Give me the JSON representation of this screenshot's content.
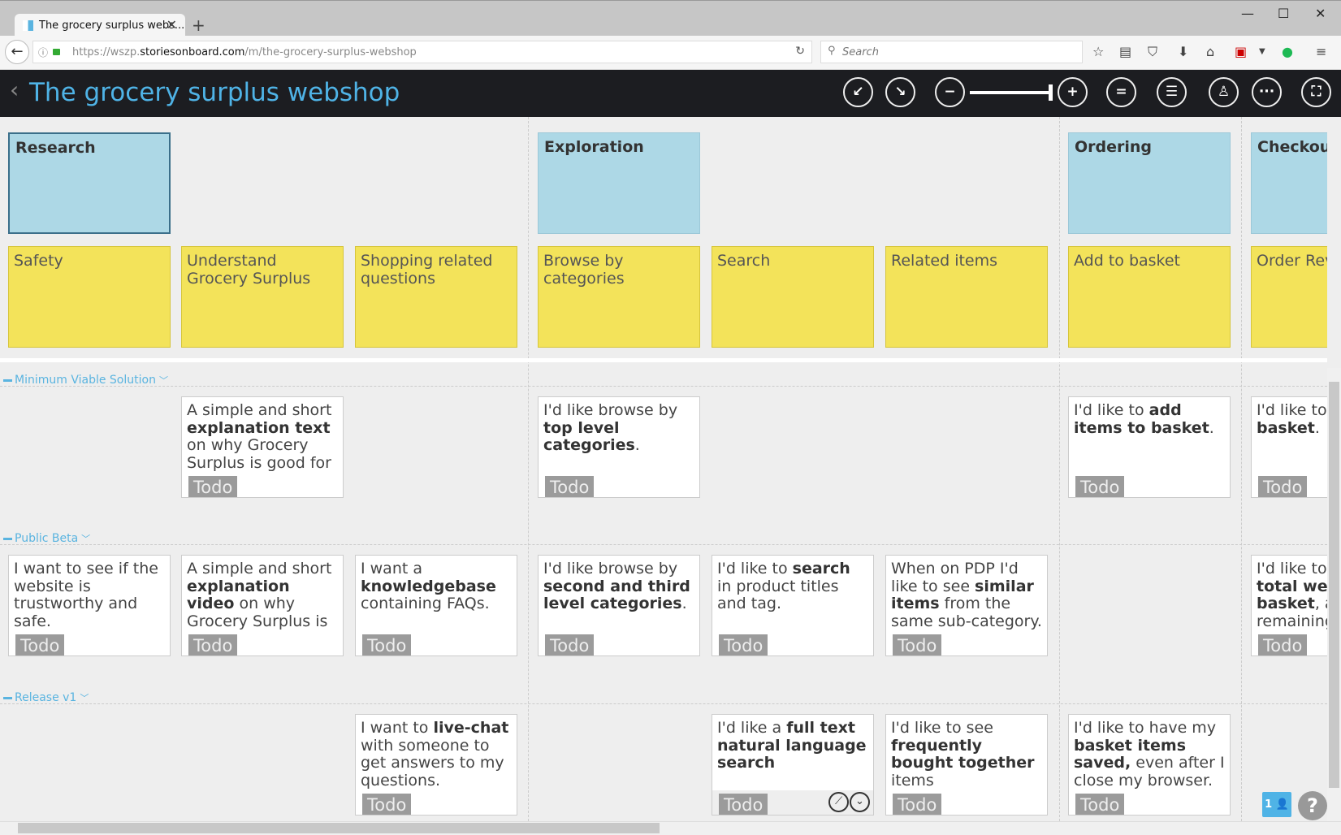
{
  "browser": {
    "tab_title": "The grocery surplus webs...",
    "url_prefix": "https://wszp.",
    "url_domain": "storiesonboard.com",
    "url_path": "/m/the-grocery-surplus-webshop",
    "search_placeholder": "Search"
  },
  "header": {
    "title": "The grocery surplus webshop"
  },
  "columns": [
    {
      "epic": "Research",
      "activity": "Safety",
      "selected": true
    },
    {
      "epic": null,
      "activity": "Understand Grocery Surplus"
    },
    {
      "epic": null,
      "activity": "Shopping related questions"
    },
    {
      "epic": "Exploration",
      "activity": "Browse by categories"
    },
    {
      "epic": null,
      "activity": "Search"
    },
    {
      "epic": null,
      "activity": "Related items"
    },
    {
      "epic": "Ordering",
      "activity": "Add to basket"
    },
    {
      "epic": "Checkout",
      "activity": "Order Review"
    }
  ],
  "releases": [
    {
      "name": "Minimum Viable Solution",
      "cards": [
        {
          "col": 1,
          "status": "Todo",
          "text": [
            {
              "t": "A simple and short "
            },
            {
              "t": "explanation text",
              "b": true
            },
            {
              "t": " on why Grocery Surplus is good for me."
            }
          ]
        },
        {
          "col": 3,
          "status": "Todo",
          "text": [
            {
              "t": "I'd like browse by "
            },
            {
              "t": "top level categories",
              "b": true
            },
            {
              "t": "."
            }
          ]
        },
        {
          "col": 6,
          "status": "Todo",
          "text": [
            {
              "t": "I'd like to "
            },
            {
              "t": "add items to basket",
              "b": true
            },
            {
              "t": "."
            }
          ]
        },
        {
          "col": 7,
          "status": "Todo",
          "text": [
            {
              "t": "I'd like to r"
            },
            {
              "t": "\nbasket",
              "b": true
            },
            {
              "t": "."
            }
          ]
        }
      ]
    },
    {
      "name": "Public Beta",
      "cards": [
        {
          "col": 0,
          "status": "Todo",
          "text": [
            {
              "t": "I want to see if the website is trustworthy and safe."
            }
          ]
        },
        {
          "col": 1,
          "status": "Todo",
          "text": [
            {
              "t": "A simple and short "
            },
            {
              "t": "explanation video",
              "b": true
            },
            {
              "t": " on why Grocery Surplus is good for me."
            }
          ]
        },
        {
          "col": 2,
          "status": "Todo",
          "text": [
            {
              "t": "I want a "
            },
            {
              "t": "knowledgebase",
              "b": true
            },
            {
              "t": " containing FAQs."
            }
          ]
        },
        {
          "col": 3,
          "status": "Todo",
          "text": [
            {
              "t": "I'd like browse by "
            },
            {
              "t": "second and third level categories",
              "b": true
            },
            {
              "t": "."
            }
          ]
        },
        {
          "col": 4,
          "status": "Todo",
          "text": [
            {
              "t": "I'd like to "
            },
            {
              "t": "search",
              "b": true
            },
            {
              "t": " in product titles and tag."
            }
          ]
        },
        {
          "col": 5,
          "status": "Todo",
          "text": [
            {
              "t": "When on PDP I'd like to see "
            },
            {
              "t": "similar items",
              "b": true
            },
            {
              "t": " from the same sub-category."
            }
          ]
        },
        {
          "col": 7,
          "status": "Todo",
          "text": [
            {
              "t": "I'd like to s\n"
            },
            {
              "t": "total weig\nbasket",
              "b": true
            },
            {
              "t": ", ar\nremaining"
            }
          ]
        }
      ]
    },
    {
      "name": "Release v1",
      "cards": [
        {
          "col": 2,
          "status": "Todo",
          "text": [
            {
              "t": "I want to "
            },
            {
              "t": "live-chat",
              "b": true
            },
            {
              "t": " with someone to get answers to my questions."
            }
          ]
        },
        {
          "col": 4,
          "status": "Todo",
          "hover": true,
          "text": [
            {
              "t": "I'd like a "
            },
            {
              "t": "full text natural language search",
              "b": true
            }
          ]
        },
        {
          "col": 5,
          "status": "Todo",
          "text": [
            {
              "t": "I'd like to see "
            },
            {
              "t": "frequently bought together",
              "b": true
            },
            {
              "t": " items"
            }
          ]
        },
        {
          "col": 6,
          "status": "Todo",
          "text": [
            {
              "t": "I'd like to have my "
            },
            {
              "t": "basket items saved,",
              "b": true
            },
            {
              "t": " even after I close my browser."
            }
          ]
        }
      ]
    }
  ],
  "footer": {
    "online_users": "1",
    "help": "?"
  }
}
